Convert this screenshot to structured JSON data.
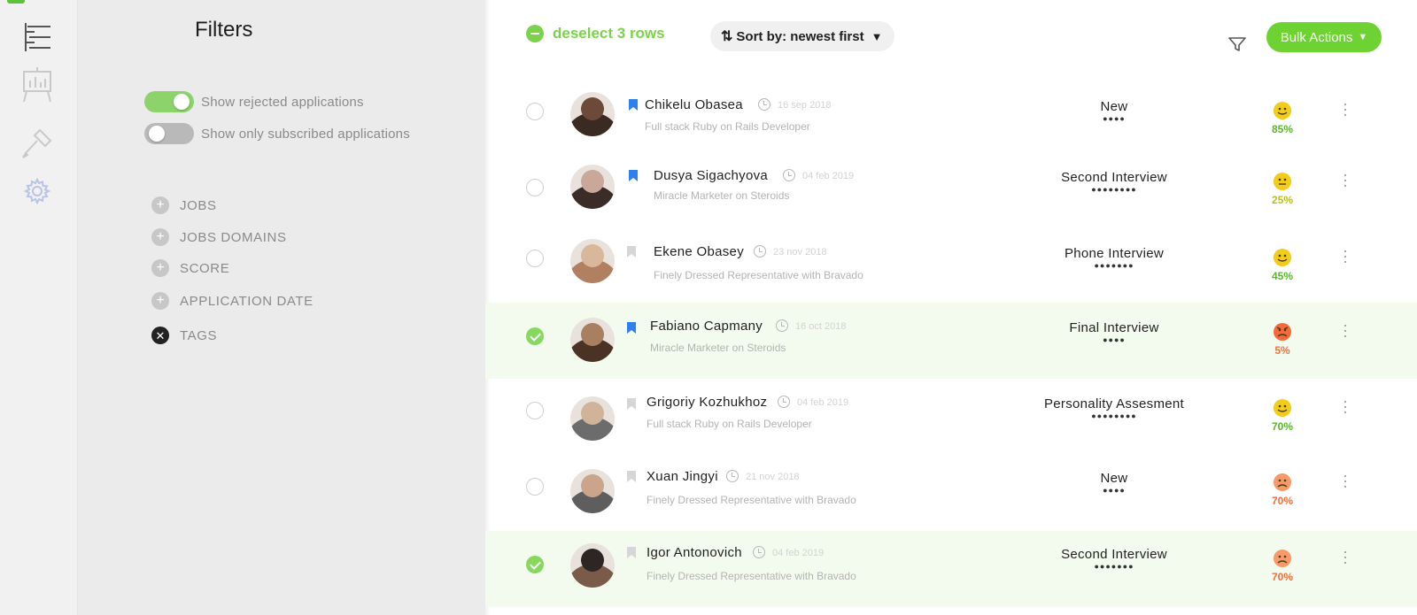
{
  "filters": {
    "title": "Filters",
    "toggles": [
      {
        "label": "Show rejected applications",
        "state": "on"
      },
      {
        "label": "Show only subscribed applications",
        "state": "off"
      }
    ],
    "categories": [
      {
        "label": "JOBS",
        "icon": "plus-circle-icon"
      },
      {
        "label": "JOBS DOMAINS",
        "icon": "plus-circle-icon"
      },
      {
        "label": "SCORE",
        "icon": "plus-circle-icon"
      },
      {
        "label": "APPLICATION DATE",
        "icon": "plus-circle-icon"
      },
      {
        "label": "TAGS",
        "icon": "close-circle-icon"
      }
    ]
  },
  "toolbar": {
    "deselect_label": "deselect 3 rows",
    "sort_label": "Sort by: newest first",
    "bulk_actions_label": "Bulk Actions"
  },
  "colors": {
    "accent_green": "#6fd233",
    "bookmark_blue": "#2f80ed",
    "score_good": "#58b82a",
    "score_ok": "#b8c21a",
    "score_bad": "#f0703a"
  },
  "candidates": [
    {
      "name": "Chikelu Obasea",
      "date": "16 sep 2018",
      "job": "Full stack Ruby on Rails Developer",
      "stage": "New",
      "stage_dots": "●●●●",
      "score": "85%",
      "mood": "happy",
      "bookmarked": true,
      "selected": false
    },
    {
      "name": "Dusya Sigachyova",
      "date": "04 feb 2019",
      "job": "Miracle Marketer on Steroids",
      "stage": "Second Interview",
      "stage_dots": "●●●●●●●●",
      "score": "25%",
      "mood": "neutral",
      "bookmarked": true,
      "selected": false
    },
    {
      "name": "Ekene Obasey",
      "date": "23 nov 2018",
      "job": "Finely Dressed Representative with Bravado",
      "stage": "Phone Interview",
      "stage_dots": "●●●●●●●",
      "score": "45%",
      "mood": "happy",
      "bookmarked": false,
      "selected": false
    },
    {
      "name": "Fabiano Capmany",
      "date": "16 oct 2018",
      "job": "Miracle Marketer on Steroids",
      "stage": "Final Interview",
      "stage_dots": "●●●●",
      "score": "5%",
      "mood": "angry",
      "bookmarked": true,
      "selected": true
    },
    {
      "name": "Grigoriy Kozhukhoz",
      "date": "04 feb 2019",
      "job": "Full stack Ruby on Rails Developer",
      "stage": "Personality Assesment",
      "stage_dots": "●●●●●●●●",
      "score": "70%",
      "mood": "happy",
      "bookmarked": false,
      "selected": false
    },
    {
      "name": "Xuan Jingyi",
      "date": "21 nov 2018",
      "job": "Finely Dressed Representative with Bravado",
      "stage": "New",
      "stage_dots": "●●●●",
      "score": "70%",
      "mood": "sad",
      "bookmarked": false,
      "selected": false
    },
    {
      "name": "Igor Antonovich",
      "date": "04 feb 2019",
      "job": "Finely Dressed Representative with Bravado",
      "stage": "Second Interview",
      "stage_dots": "●●●●●●●",
      "score": "70%",
      "mood": "sad",
      "bookmarked": false,
      "selected": true
    }
  ]
}
